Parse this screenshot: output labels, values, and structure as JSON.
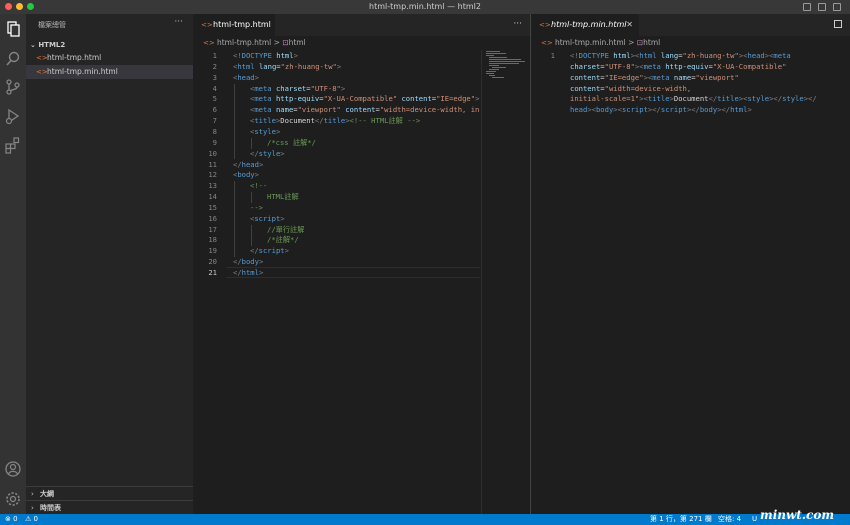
{
  "window": {
    "title": "html-tmp.min.html — html2"
  },
  "sidebar": {
    "header": "檔案總管",
    "more": "···",
    "folder": "HTML2",
    "files": [
      "html-tmp.html",
      "html-tmp.min.html"
    ],
    "sections": [
      "大綱",
      "時間表"
    ]
  },
  "left_editor": {
    "tab_label": "html-tmp.html",
    "tab_close": "✕",
    "breadcrumb": {
      "file": "html-tmp.html",
      "sep": ">",
      "symbol": "html"
    },
    "line_numbers": [
      "1",
      "2",
      "3",
      "4",
      "5",
      "6",
      "7",
      "8",
      "9",
      "10",
      "11",
      "12",
      "13",
      "14",
      "15",
      "16",
      "17",
      "18",
      "19",
      "20",
      "21"
    ]
  },
  "right_editor": {
    "tab_label": "html-tmp.min.html",
    "tab_close": "✕",
    "breadcrumb": {
      "file": "html-tmp.min.html",
      "sep": ">",
      "symbol": "html"
    },
    "line_numbers": [
      "1"
    ]
  },
  "status_bar": {
    "errors": "0",
    "warnings": "0",
    "position": "第 1 行，第 271 欄",
    "spaces": "空格: 4",
    "encoding": "U",
    "watermark": "minwt.com"
  },
  "colors": {
    "accent": "#007acc",
    "tag": "#569cd6",
    "attr": "#9cdcfe",
    "string": "#ce9178",
    "comment": "#6a9955"
  }
}
